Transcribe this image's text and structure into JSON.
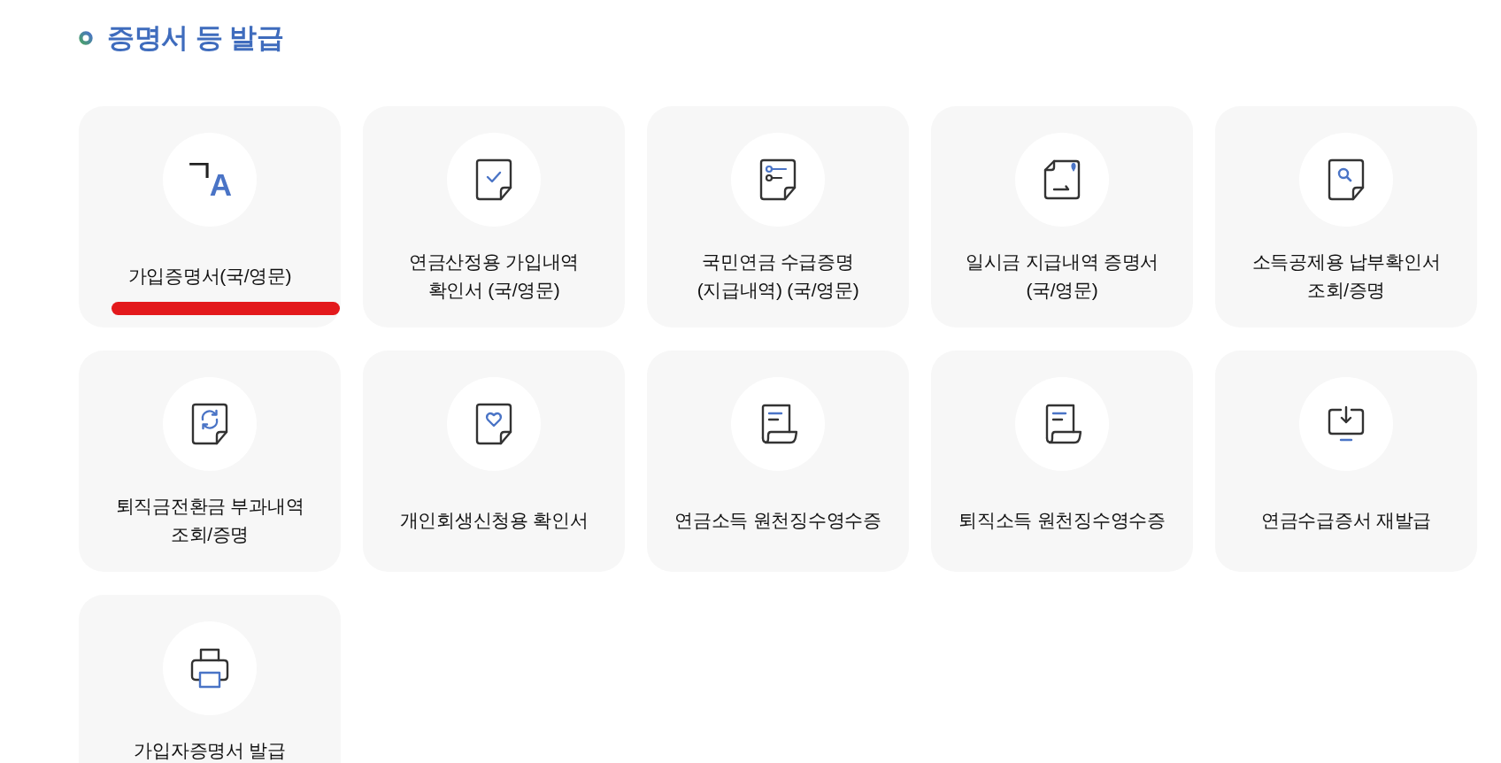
{
  "section": {
    "title": "증명서 등 발급"
  },
  "cards": [
    {
      "lines": [
        "가입증명서(국/영문)"
      ],
      "icon_glyphs": [
        "ㄱ",
        "A"
      ],
      "marked": true
    },
    {
      "lines": [
        "연금산정용 가입내역",
        "확인서 (국/영문)"
      ],
      "marked": false
    },
    {
      "lines": [
        "국민연금 수급증명",
        "(지급내역) (국/영문)"
      ],
      "marked": false
    },
    {
      "lines": [
        "일시금 지급내역 증명서",
        "(국/영문)"
      ],
      "marked": false
    },
    {
      "lines": [
        "소득공제용 납부확인서",
        "조회/증명"
      ],
      "marked": false
    },
    {
      "lines": [
        "퇴직금전환금 부과내역",
        "조회/증명"
      ],
      "marked": false
    },
    {
      "lines": [
        "개인회생신청용 확인서"
      ],
      "marked": false
    },
    {
      "lines": [
        "연금소득 원천징수영수증"
      ],
      "marked": false
    },
    {
      "lines": [
        "퇴직소득 원천징수영수증"
      ],
      "marked": false
    },
    {
      "lines": [
        "연금수급증서 재발급"
      ],
      "marked": false
    },
    {
      "lines": [
        "가입자증명서 발급"
      ],
      "marked": false
    }
  ]
}
